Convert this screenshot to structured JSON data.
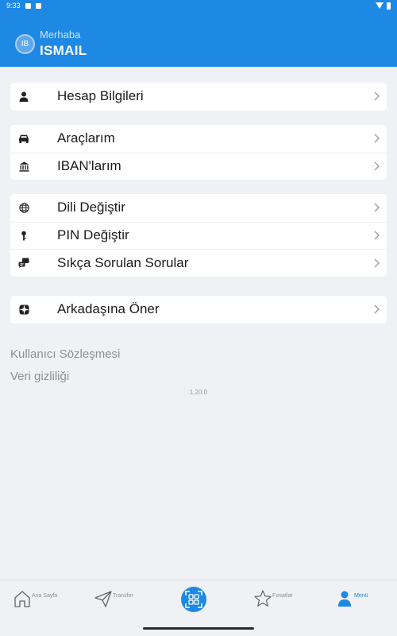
{
  "status_bar": {
    "time": "9:33"
  },
  "header": {
    "avatar_initials": "IB",
    "greeting": "Merhaba",
    "username": "ISMAIL"
  },
  "menu": {
    "groups": [
      {
        "items": [
          {
            "label": "Hesap Bilgileri",
            "icon": "person-icon"
          }
        ]
      },
      {
        "items": [
          {
            "label": "Araçlarım",
            "icon": "car-icon"
          },
          {
            "label": "IBAN'larım",
            "icon": "bank-icon"
          }
        ]
      },
      {
        "items": [
          {
            "label": "Dili Değiştir",
            "icon": "globe-icon"
          },
          {
            "label": "PIN Değiştir",
            "icon": "key-icon"
          },
          {
            "label": "Sıkça Sorulan Sorular",
            "icon": "faq-chat-icon"
          }
        ]
      },
      {
        "items": [
          {
            "label": "Arkadaşına Öner",
            "icon": "share-icon"
          }
        ]
      }
    ]
  },
  "links": {
    "user_agreement": "Kullanıcı Sözleşmesi",
    "privacy": "Veri gizliliği"
  },
  "version": "1.20.0",
  "bottom_nav": {
    "home": "Ana Sayfa",
    "transfer": "Transfer",
    "deals": "Fırsatlar",
    "menu": "Menü",
    "active": "menu"
  },
  "colors": {
    "primary": "#1e88e5",
    "background": "#f0f1f5",
    "card": "#ffffff",
    "muted_text": "#8e8e93"
  }
}
